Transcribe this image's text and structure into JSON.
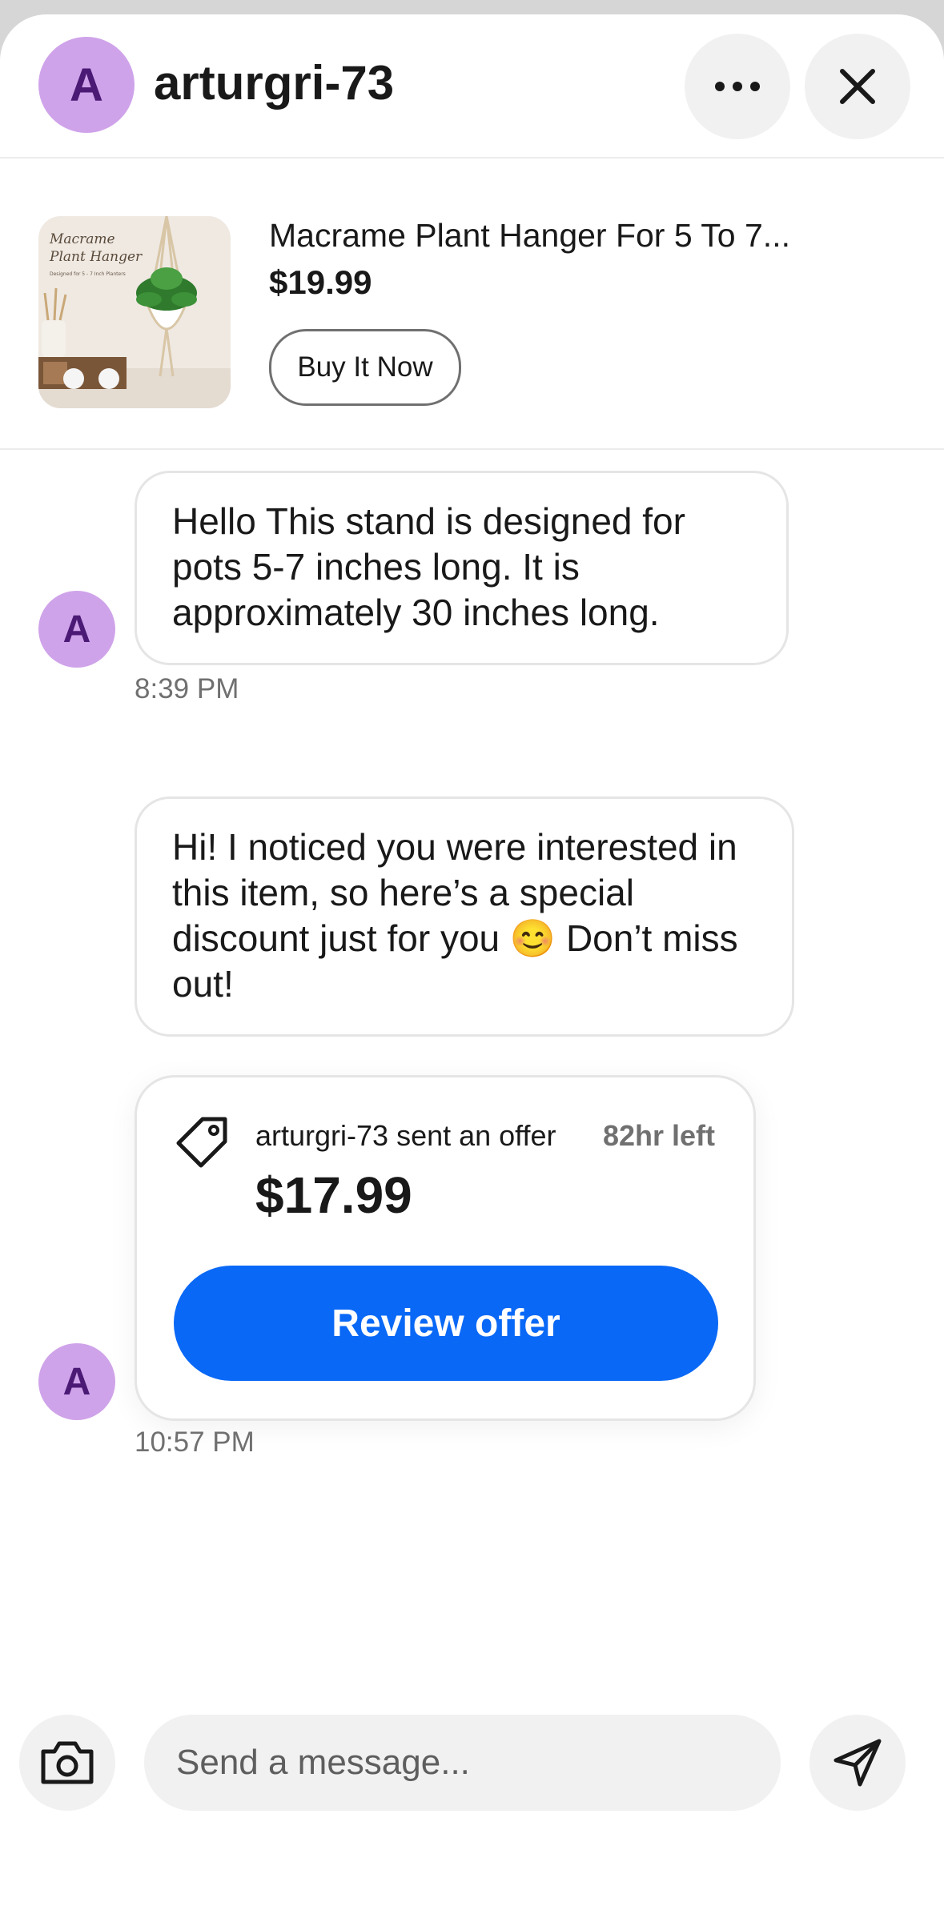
{
  "header": {
    "avatar_letter": "A",
    "username": "arturgri-73"
  },
  "icons": {
    "more": "more-horizontal-icon",
    "close": "close-icon",
    "camera": "camera-icon",
    "send": "send-icon",
    "tag": "price-tag-icon"
  },
  "product": {
    "image_text_line1": "Macrame",
    "image_text_line2": "Plant Hanger",
    "image_text_line3": "Designed for 5 - 7 Inch Planters",
    "title": "Macrame Plant Hanger For 5 To 7...",
    "price": "$19.99",
    "buy_label": "Buy It Now"
  },
  "messages": [
    {
      "avatar_letter": "A",
      "text": "Hello This stand is designed for pots 5-7 inches long. It is approximately 30 inches long.",
      "time": "8:39 PM"
    },
    {
      "text": "Hi! I noticed you were interested in this item, so here’s a special discount just for you 😊 Don’t miss out!"
    }
  ],
  "offer": {
    "avatar_letter": "A",
    "sender_text": "arturgri-73 sent an offer",
    "time_left": "82hr left",
    "price": "$17.99",
    "button_label": "Review offer",
    "time": "10:57 PM"
  },
  "composer": {
    "placeholder": "Send a message..."
  },
  "colors": {
    "accent": "#0968f6",
    "avatar_bg": "#cfa3ea",
    "avatar_text": "#4a1a75"
  }
}
